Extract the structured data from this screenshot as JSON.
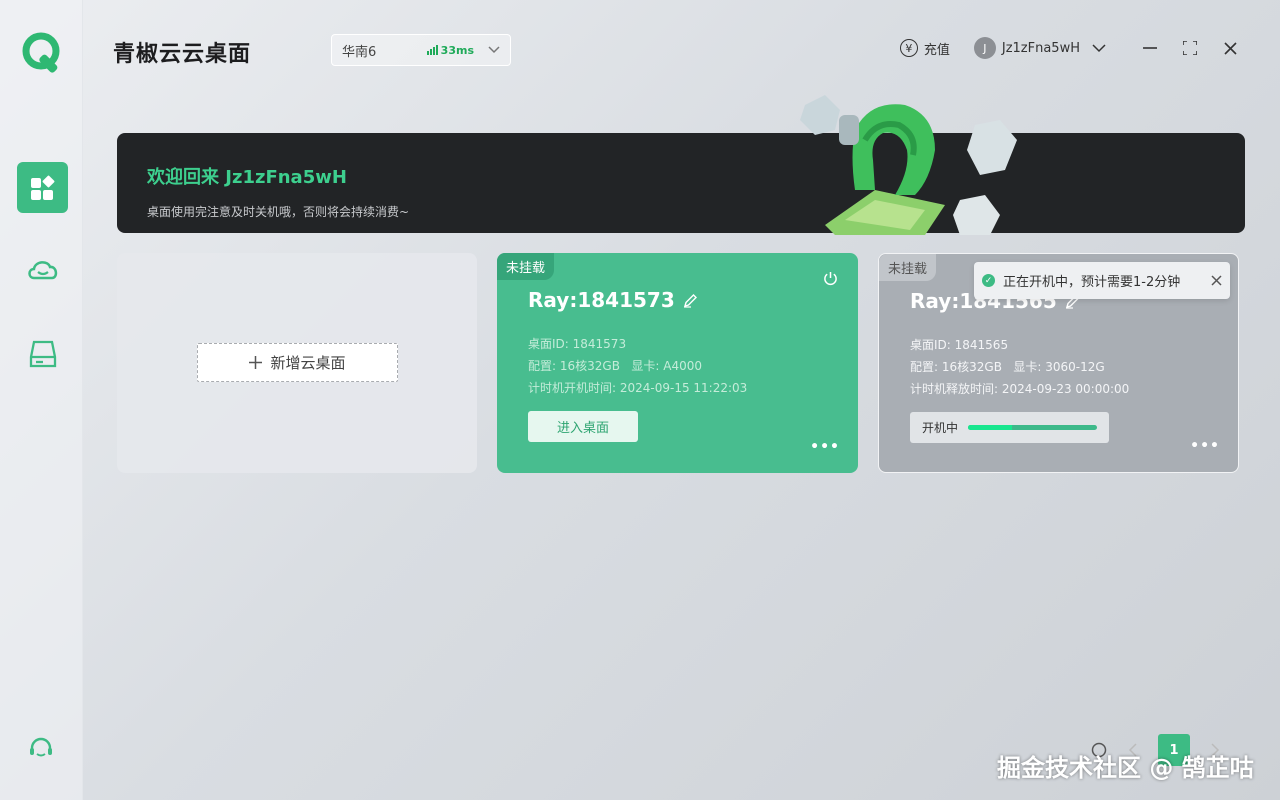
{
  "app": {
    "title": "青椒云云桌面"
  },
  "region": {
    "name": "华南6",
    "ping": "33ms"
  },
  "header": {
    "recharge": "充值",
    "avatar_initial": "J",
    "username": "Jz1zFna5wH"
  },
  "banner": {
    "title": "欢迎回来 Jz1zFna5wH",
    "subtitle": "桌面使用完注意及时关机哦，否则将会持续消费~"
  },
  "add_card": {
    "label": "新增云桌面"
  },
  "desktops": [
    {
      "tag": "未挂载",
      "name": "Ray:1841573",
      "id_line": "桌面ID: 1841573",
      "config_line": "配置: 16核32GB   显卡: A4000",
      "time_line": "计时机开机时间: 2024-09-15 11:22:03",
      "action": "进入桌面"
    },
    {
      "tag": "未挂载",
      "name": "Ray:1841565",
      "id_line": "桌面ID: 1841565",
      "config_line": "配置: 16核32GB   显卡: 3060-12G",
      "time_line": "计时机释放时间: 2024-09-23 00:00:00",
      "status": "开机中",
      "progress": 0.34
    }
  ],
  "toast": {
    "message": "正在开机中，预计需要1-2分钟"
  },
  "pagination": {
    "current": "1"
  },
  "watermark": "掘金技术社区 @ 鹄芷咕",
  "colors": {
    "accent": "#3dbb84",
    "banner_bg": "#222426",
    "card_green": "#48bd8f",
    "card_grey": "#a9aeb4"
  }
}
